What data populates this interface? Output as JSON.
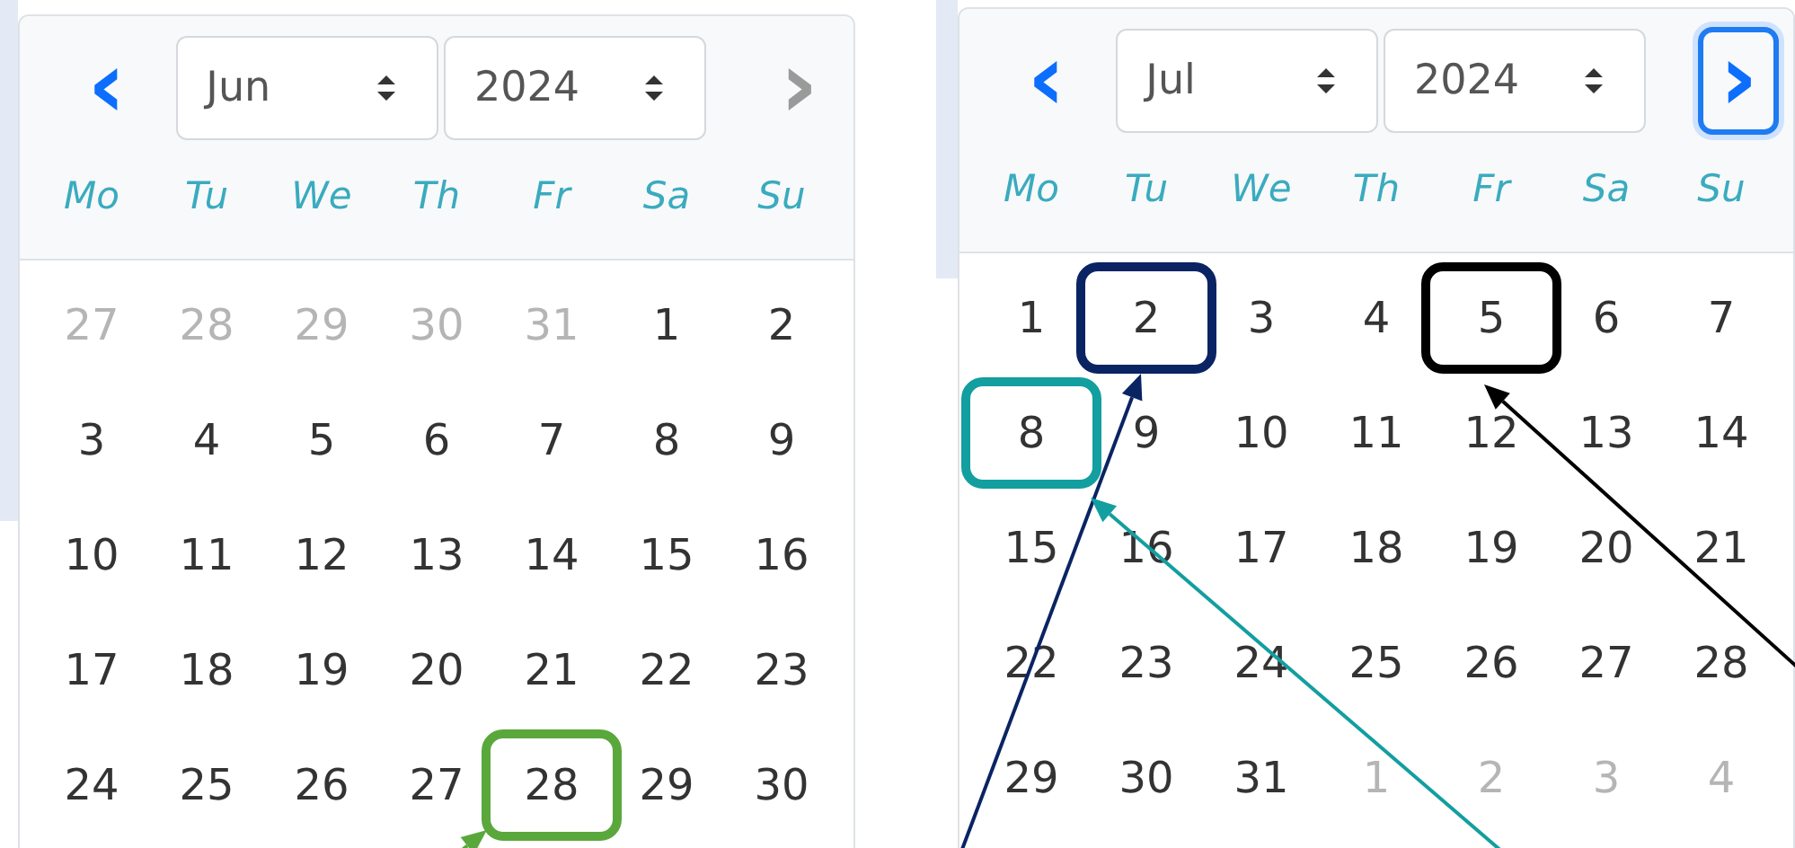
{
  "calendars": [
    {
      "prev": {
        "glyph": "‹",
        "disabled": false,
        "focused": false
      },
      "month": "Jun",
      "year": "2024",
      "next": {
        "glyph": "›",
        "disabled": true,
        "focused": false
      },
      "weekdays": [
        "Mo",
        "Tu",
        "We",
        "Th",
        "Fr",
        "Sa",
        "Su"
      ],
      "days": [
        {
          "label": "27",
          "muted": true
        },
        {
          "label": "28",
          "muted": true
        },
        {
          "label": "29",
          "muted": true
        },
        {
          "label": "30",
          "muted": true
        },
        {
          "label": "31",
          "muted": true
        },
        {
          "label": "1",
          "muted": false
        },
        {
          "label": "2",
          "muted": false
        },
        {
          "label": "3",
          "muted": false
        },
        {
          "label": "4",
          "muted": false
        },
        {
          "label": "5",
          "muted": false
        },
        {
          "label": "6",
          "muted": false
        },
        {
          "label": "7",
          "muted": false
        },
        {
          "label": "8",
          "muted": false
        },
        {
          "label": "9",
          "muted": false
        },
        {
          "label": "10",
          "muted": false
        },
        {
          "label": "11",
          "muted": false
        },
        {
          "label": "12",
          "muted": false
        },
        {
          "label": "13",
          "muted": false
        },
        {
          "label": "14",
          "muted": false
        },
        {
          "label": "15",
          "muted": false
        },
        {
          "label": "16",
          "muted": false
        },
        {
          "label": "17",
          "muted": false
        },
        {
          "label": "18",
          "muted": false
        },
        {
          "label": "19",
          "muted": false
        },
        {
          "label": "20",
          "muted": false
        },
        {
          "label": "21",
          "muted": false
        },
        {
          "label": "22",
          "muted": false
        },
        {
          "label": "23",
          "muted": false
        },
        {
          "label": "24",
          "muted": false
        },
        {
          "label": "25",
          "muted": false
        },
        {
          "label": "26",
          "muted": false
        },
        {
          "label": "27",
          "muted": false
        },
        {
          "label": "28",
          "muted": false,
          "color": "#5aa83c"
        },
        {
          "label": "29",
          "muted": false
        },
        {
          "label": "30",
          "muted": false
        }
      ]
    },
    {
      "prev": {
        "glyph": "‹",
        "disabled": false,
        "focused": false
      },
      "month": "Jul",
      "year": "2024",
      "next": {
        "glyph": "›",
        "disabled": false,
        "focused": true
      },
      "weekdays": [
        "Mo",
        "Tu",
        "We",
        "Th",
        "Fr",
        "Sa",
        "Su"
      ],
      "days": [
        {
          "label": "1",
          "muted": false
        },
        {
          "label": "2",
          "muted": false,
          "color": "#0a2463"
        },
        {
          "label": "3",
          "muted": false
        },
        {
          "label": "4",
          "muted": false
        },
        {
          "label": "5",
          "muted": false,
          "color": "#000000"
        },
        {
          "label": "6",
          "muted": false
        },
        {
          "label": "7",
          "muted": false
        },
        {
          "label": "8",
          "muted": false,
          "color": "#139ea0"
        },
        {
          "label": "9",
          "muted": false
        },
        {
          "label": "10",
          "muted": false
        },
        {
          "label": "11",
          "muted": false
        },
        {
          "label": "12",
          "muted": false
        },
        {
          "label": "13",
          "muted": false
        },
        {
          "label": "14",
          "muted": false
        },
        {
          "label": "15",
          "muted": false
        },
        {
          "label": "16",
          "muted": false
        },
        {
          "label": "17",
          "muted": false
        },
        {
          "label": "18",
          "muted": false
        },
        {
          "label": "19",
          "muted": false
        },
        {
          "label": "20",
          "muted": false
        },
        {
          "label": "21",
          "muted": false
        },
        {
          "label": "22",
          "muted": false
        },
        {
          "label": "23",
          "muted": false
        },
        {
          "label": "24",
          "muted": false
        },
        {
          "label": "25",
          "muted": false
        },
        {
          "label": "26",
          "muted": false
        },
        {
          "label": "27",
          "muted": false
        },
        {
          "label": "28",
          "muted": false
        },
        {
          "label": "29",
          "muted": false
        },
        {
          "label": "30",
          "muted": false
        },
        {
          "label": "31",
          "muted": false
        },
        {
          "label": "1",
          "muted": true
        },
        {
          "label": "2",
          "muted": true
        },
        {
          "label": "3",
          "muted": true
        },
        {
          "label": "4",
          "muted": true
        }
      ]
    }
  ]
}
